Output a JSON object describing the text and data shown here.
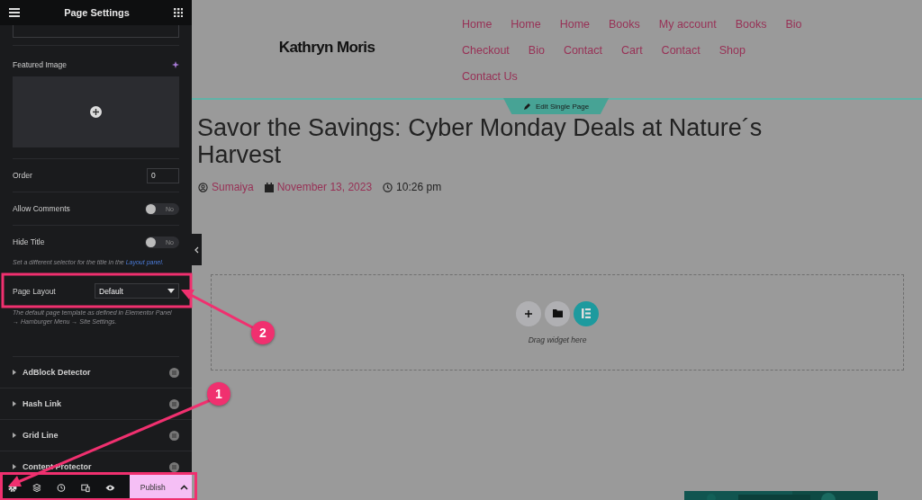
{
  "panel": {
    "title": "Page Settings",
    "featured_image": {
      "label": "Featured Image"
    },
    "fields": [
      {
        "kind": "input",
        "label": "Order",
        "value": "0"
      },
      {
        "kind": "toggle",
        "label": "Allow Comments",
        "on": false,
        "state_label": "No"
      },
      {
        "kind": "toggle",
        "label": "Hide Title",
        "on": false,
        "state_label": "No"
      }
    ],
    "hide_title_hint": {
      "text": "Set a different selector for the title in the",
      "link": "Layout panel."
    },
    "page_layout": {
      "label": "Page Layout",
      "value": "Default",
      "description": "The default page template as defined in Elementor Panel → Hamburger Menu → Site Settings."
    },
    "sections": [
      {
        "label": "AdBlock Detector",
        "expanded": false
      },
      {
        "label": "Hash Link",
        "expanded": false
      },
      {
        "label": "Grid Line",
        "expanded": false
      },
      {
        "label": "Content Protector",
        "expanded": false
      }
    ],
    "footer": {
      "publish": "Publish"
    }
  },
  "site": {
    "logo": "Kathryn Moris",
    "menu": [
      "Home",
      "Home",
      "Home",
      "Books",
      "My account",
      "Books",
      "Bio",
      "Checkout",
      "Bio",
      "Contact",
      "Cart",
      "Contact",
      "Shop",
      "Contact Us"
    ],
    "edit_tab": "Edit Single Page",
    "post": {
      "title": "Savor the Savings: Cyber Monday Deals at Nature´s Harvest",
      "author": "Sumaiya",
      "date": "November 13, 2023",
      "time": "10:26 pm"
    },
    "drop_zone": {
      "hint": "Drag widget here"
    }
  },
  "annotations": [
    {
      "number": "2"
    },
    {
      "number": "1"
    }
  ]
}
